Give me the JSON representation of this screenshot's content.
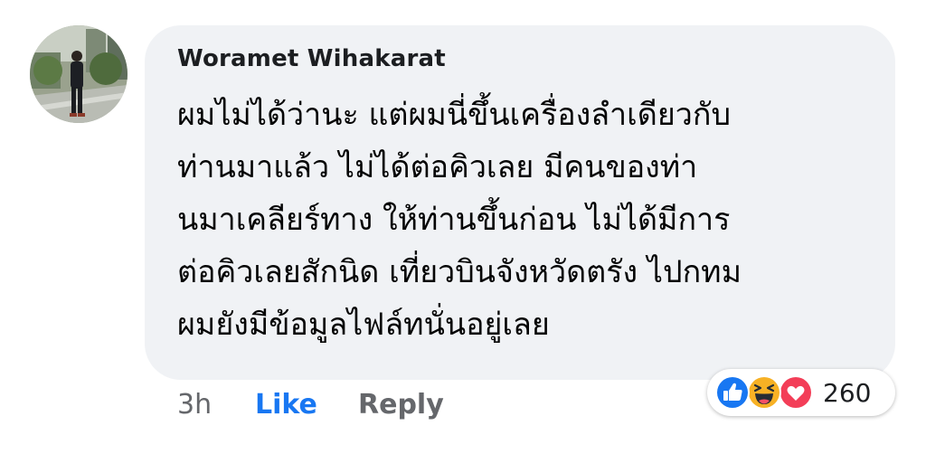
{
  "comment": {
    "author": "Woramet Wihakarat",
    "text_lines": [
      "ผมไม่ได้ว่านะ แต่ผมนี่ขึ้นเครื่องลำเดียวกับ",
      "ท่านมาแล้ว ไม่ได้ต่อคิวเลย มีคนของท่า",
      "นมาเคลียร์ทาง ให้ท่านขึ้นก่อน ไม่ได้มีการ",
      "ต่อคิวเลยสักนิด เที่ยวบินจังหวัดตรัง ไปกทม",
      "ผมยังมีข้อมูลไฟล์ทนั่นอยู่เลย"
    ]
  },
  "actions": {
    "time": "3h",
    "like_label": "Like",
    "reply_label": "Reply"
  },
  "reactions": {
    "icons": [
      "like-icon",
      "haha-icon",
      "love-icon"
    ],
    "count": "260"
  },
  "colors": {
    "like_blue": "#1877f2",
    "bubble_bg": "#f0f2f5",
    "secondary_text": "#65676b",
    "love_red": "#f33e58",
    "haha_yellow": "#f7b125"
  }
}
